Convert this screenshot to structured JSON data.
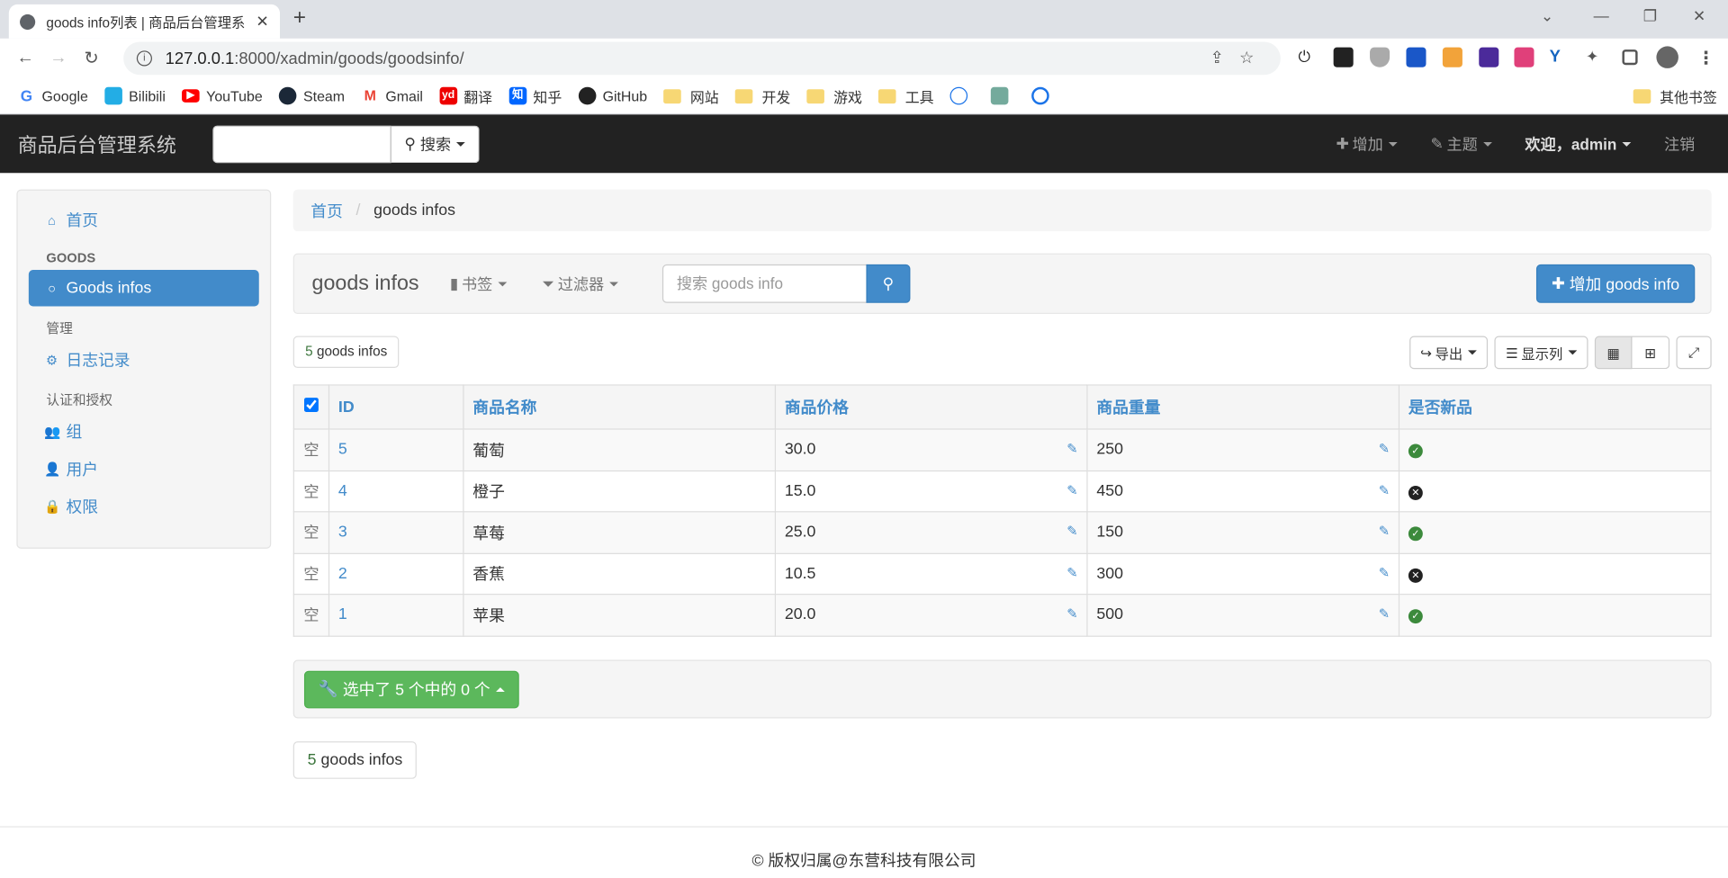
{
  "browser": {
    "tab_title": "goods info列表 | 商品后台管理系",
    "url_host": "127.0.0.1",
    "url_rest": ":8000/xadmin/goods/goodsinfo/",
    "bookmarks": [
      "Google",
      "Bilibili",
      "YouTube",
      "Steam",
      "Gmail",
      "翻译",
      "知乎",
      "GitHub",
      "网站",
      "开发",
      "游戏",
      "工具"
    ],
    "other_bookmarks": "其他书签"
  },
  "navbar": {
    "brand": "商品后台管理系统",
    "search_label": "搜索",
    "add_label": "增加",
    "theme_label": "主题",
    "welcome_label": "欢迎，",
    "user": "admin",
    "logout_label": "注销"
  },
  "sidebar": {
    "home": "首页",
    "section_goods": "GOODS",
    "goods_infos": "Goods infos",
    "section_admin": "管理",
    "log": "日志记录",
    "section_auth": "认证和授权",
    "group": "组",
    "user": "用户",
    "perm": "权限"
  },
  "breadcrumb": {
    "home": "首页",
    "current": "goods infos"
  },
  "toolbar": {
    "title": "goods infos",
    "bookmarks_label": "书签",
    "filter_label": "过滤器",
    "search_placeholder": "搜索 goods info",
    "add_button": "增加 goods info"
  },
  "count": {
    "n": "5",
    "label": " goods infos"
  },
  "tools": {
    "export": "导出",
    "columns": "显示列"
  },
  "table": {
    "headers": [
      "ID",
      "商品名称",
      "商品价格",
      "商品重量",
      "是否新品"
    ],
    "empty_label": "空",
    "rows": [
      {
        "id": "5",
        "name": "葡萄",
        "price": "30.0",
        "weight": "250",
        "is_new": true
      },
      {
        "id": "4",
        "name": "橙子",
        "price": "15.0",
        "weight": "450",
        "is_new": false
      },
      {
        "id": "3",
        "name": "草莓",
        "price": "25.0",
        "weight": "150",
        "is_new": true
      },
      {
        "id": "2",
        "name": "香蕉",
        "price": "10.5",
        "weight": "300",
        "is_new": false
      },
      {
        "id": "1",
        "name": "苹果",
        "price": "20.0",
        "weight": "500",
        "is_new": true
      }
    ]
  },
  "actions": {
    "selected_label": "选中了 5 个中的 0 个"
  },
  "footer": {
    "copyright": "© 版权归属@东营科技有限公司"
  }
}
